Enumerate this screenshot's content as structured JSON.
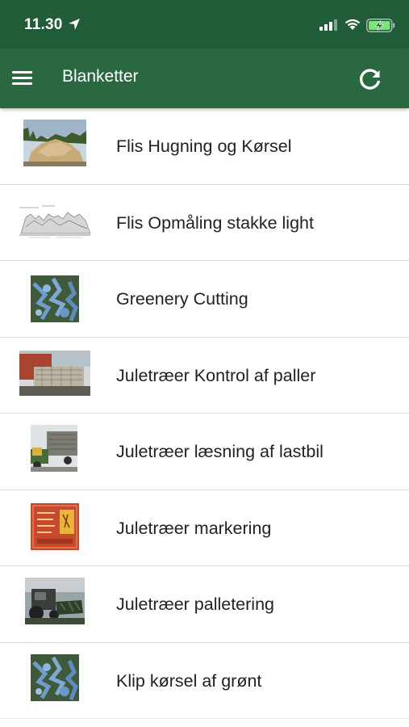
{
  "status_bar": {
    "time": "11.30",
    "icons": [
      "location-arrow-icon",
      "cellular-signal-icon",
      "wifi-icon",
      "battery-charging-icon"
    ]
  },
  "app_bar": {
    "title": "Blanketter",
    "menu_icon": "hamburger-menu-icon",
    "refresh_icon": "refresh-icon"
  },
  "colors": {
    "status_bar": "#205c37",
    "app_bar": "#2a6841",
    "text": "#222222",
    "divider": "#dedede"
  },
  "forms": [
    {
      "label": "Flis Hugning og Kørsel",
      "thumb": "woodchip-pile-thumbnail"
    },
    {
      "label": "Flis Opmåling stakke light",
      "thumb": "stack-measurement-diagram-thumbnail"
    },
    {
      "label": "Greenery Cutting",
      "thumb": "fir-branches-thumbnail"
    },
    {
      "label": "Juletræer Kontrol af paller",
      "thumb": "christmas-tree-pallets-thumbnail"
    },
    {
      "label": "Juletræer læsning af lastbil",
      "thumb": "truck-loading-thumbnail"
    },
    {
      "label": "Juletræer markering",
      "thumb": "tree-label-tag-thumbnail"
    },
    {
      "label": "Juletræer palletering",
      "thumb": "tractor-palletizing-thumbnail"
    },
    {
      "label": "Klip kørsel af grønt",
      "thumb": "fir-branches-thumbnail"
    }
  ]
}
